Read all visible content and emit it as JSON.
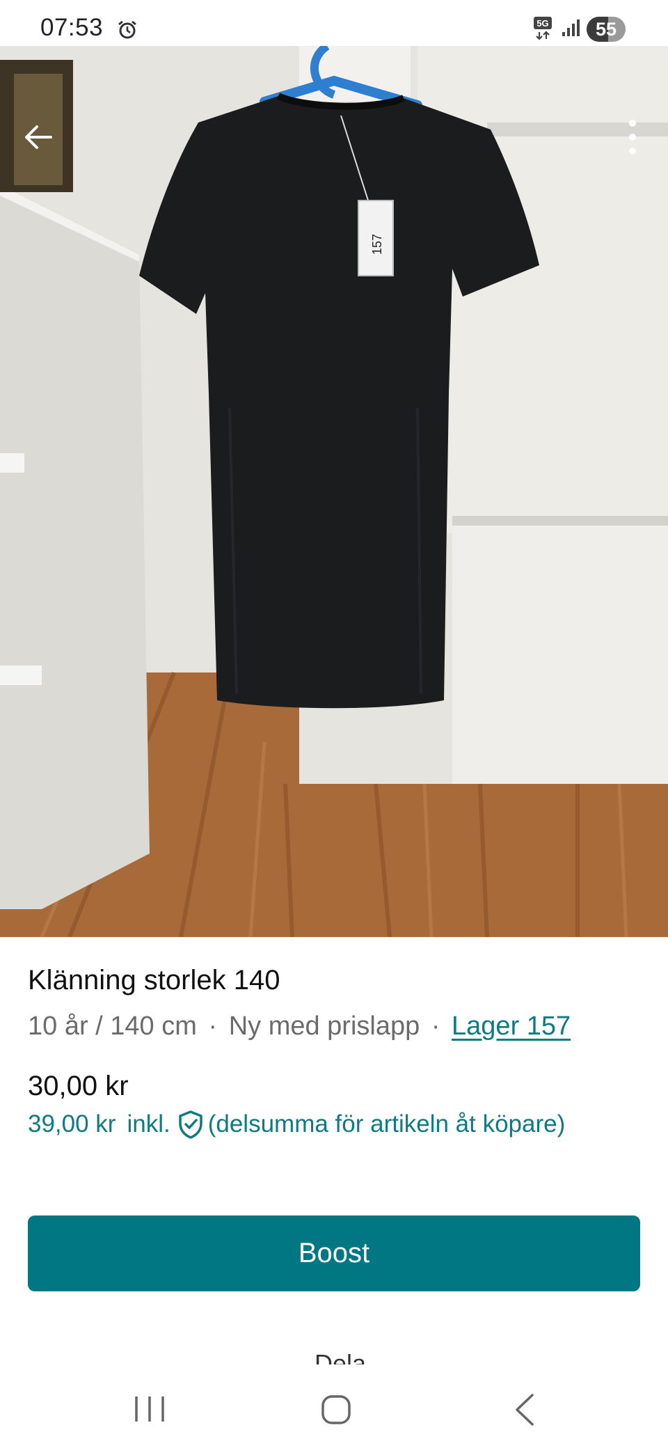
{
  "status_bar": {
    "time": "07:53",
    "network": "5G",
    "battery_level": "55",
    "battery_fraction": 0.55
  },
  "gallery": {
    "image_count": 5,
    "active_index": 0,
    "description_icon_names": [
      "arrow-left-icon",
      "more-vertical-icon"
    ]
  },
  "item": {
    "title": "Klänning storlek 140",
    "size": "10 år / 140 cm",
    "separator": "·",
    "condition": "Ny med prislapp",
    "location_link": "Lager 157"
  },
  "pricing": {
    "price": "30,00 kr",
    "price_incl": "39,00 kr",
    "incl_label": "inkl.",
    "incl_note": "(delsumma för artikeln åt köpare)"
  },
  "actions": {
    "boost_label": "Boost",
    "cutoff_label": "Dela"
  },
  "colors": {
    "accent": "#007782",
    "link": "#0e7a82",
    "text": "#111111",
    "muted": "#6b6b6b"
  }
}
